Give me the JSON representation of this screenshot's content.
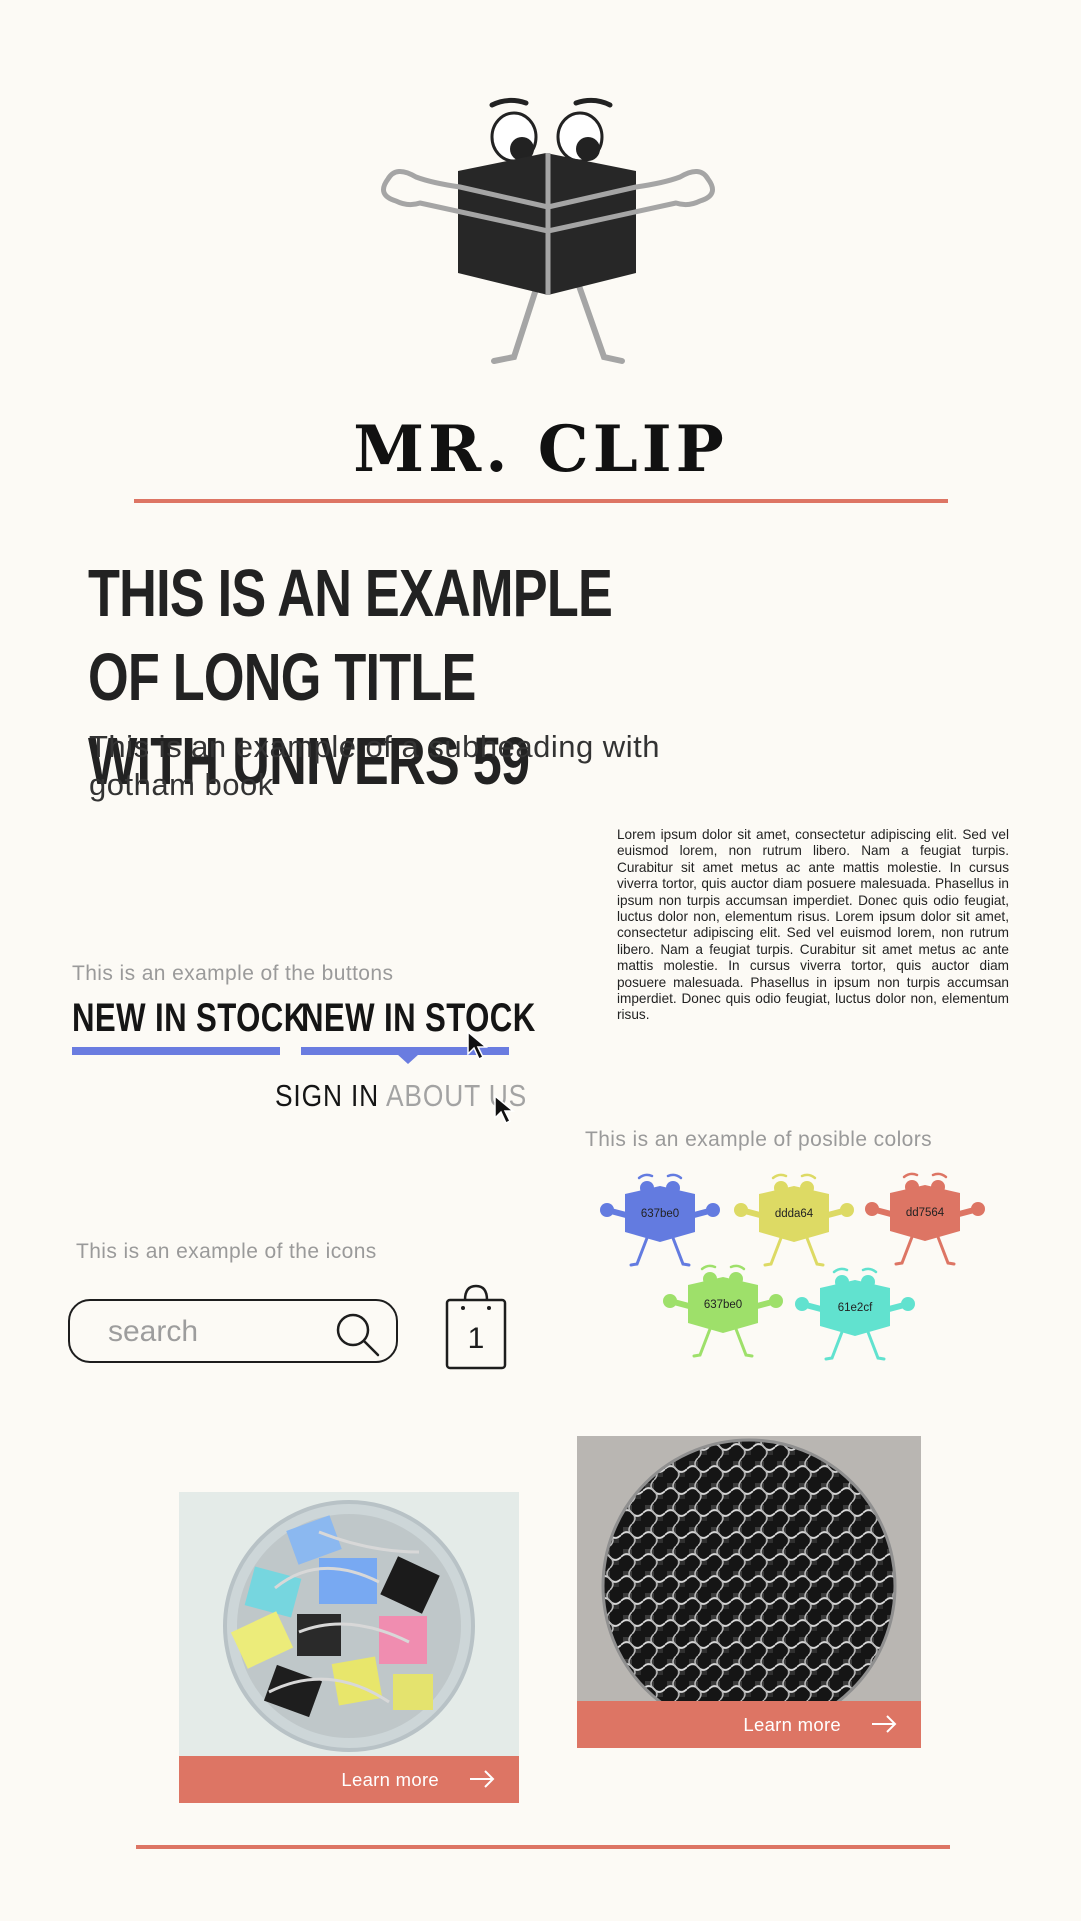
{
  "brand": {
    "name": "MR. CLIP"
  },
  "intro": {
    "title": "THIS IS AN EXAMPLE OF LONG TITLE WITH UNIVERS 59",
    "subheading": "This is an example of a subheading with gotham book",
    "body": "Lorem ipsum dolor sit amet, consectetur adipiscing elit. Sed vel euismod lorem, non rutrum libero. Nam a feugiat turpis. Curabitur sit amet metus ac ante mattis molestie. In cursus viverra tortor, quis auctor diam posuere malesuada. Phasellus in ipsum non turpis accumsan imperdiet. Donec quis odio feugiat, luctus dolor non, elementum risus. Lorem ipsum dolor sit amet, consectetur adipiscing elit. Sed vel euismod lorem, non rutrum libero. Nam a feugiat turpis. Curabitur sit amet metus ac ante mattis molestie. In cursus viverra tortor, quis auctor diam posuere malesuada. Phasellus in ipsum non turpis accumsan imperdiet. Donec quis odio feugiat, luctus dolor non, elementum risus."
  },
  "buttons": {
    "caption": "This is an example of the buttons",
    "primary": [
      "NEW IN STOCK",
      "NEW IN STOCK"
    ],
    "nav": {
      "sign_in": "SIGN IN",
      "about_us": "ABOUT US"
    }
  },
  "colors": {
    "caption": "This is an example of posible colors",
    "swatches": [
      {
        "label": "637be0",
        "hex": "#637be0"
      },
      {
        "label": "ddda64",
        "hex": "#ddda64"
      },
      {
        "label": "dd7564",
        "hex": "#dd7564"
      },
      {
        "label": "637be0",
        "hex": "#9ee06a"
      },
      {
        "label": "61e2cf",
        "hex": "#61e2cf"
      }
    ]
  },
  "icons": {
    "caption": "This is an example of the icons",
    "search_placeholder": "search",
    "cart_count": "1"
  },
  "cards": [
    {
      "cta": "Learn more"
    },
    {
      "cta": "Learn more"
    }
  ],
  "theme": {
    "accent": "#dd7564",
    "button_bar": "#6a7ce0",
    "background": "#fcfaf5",
    "ink": "#262626"
  }
}
